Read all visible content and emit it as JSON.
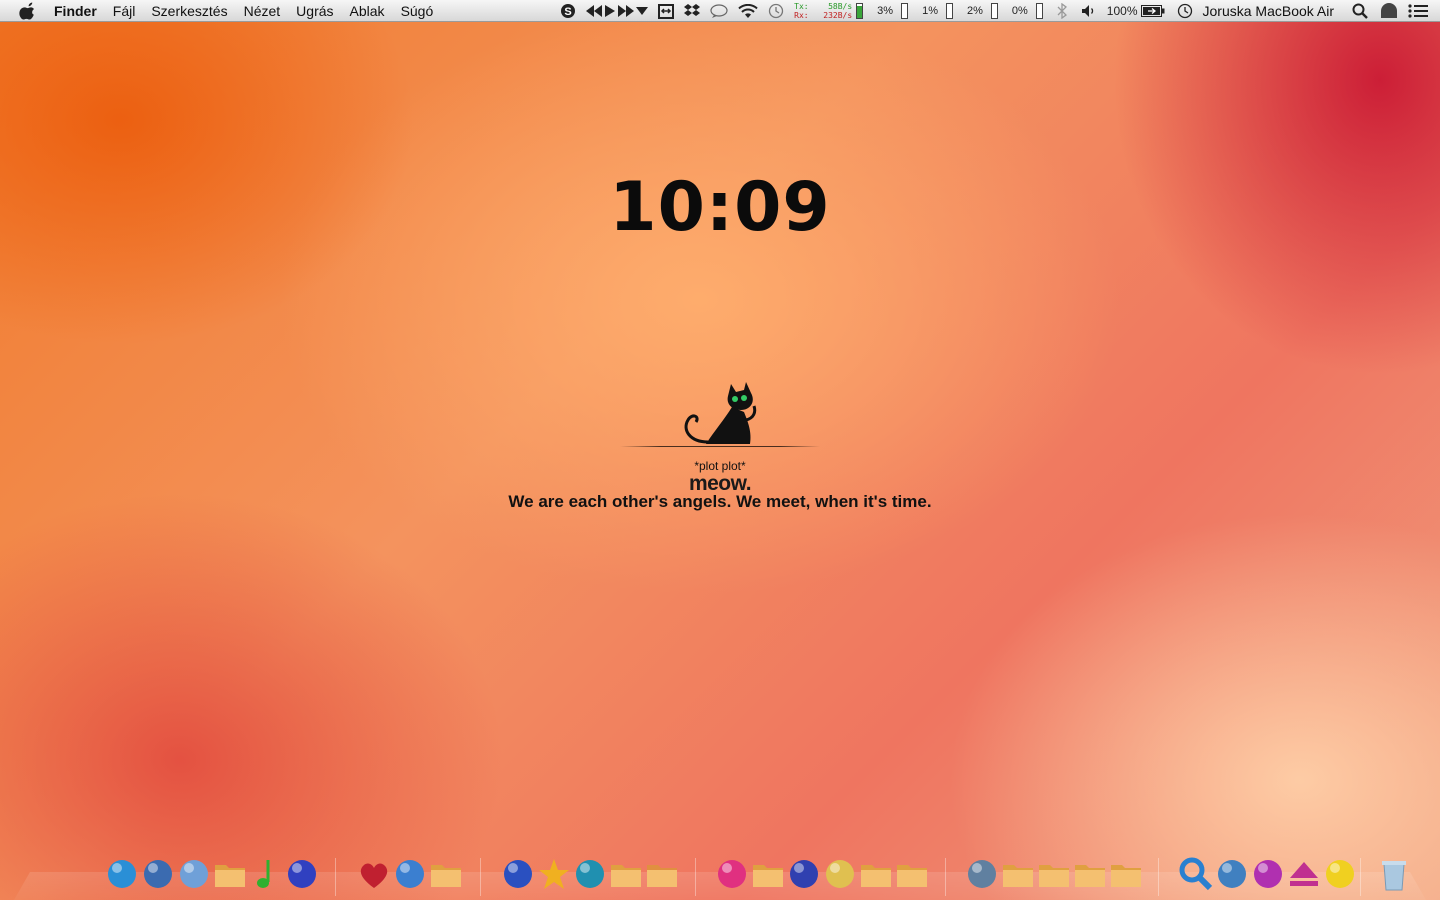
{
  "menubar": {
    "app_name": "Finder",
    "items": [
      "Fájl",
      "Szerkesztés",
      "Nézet",
      "Ugrás",
      "Ablak",
      "Súgó"
    ],
    "network": {
      "tx_label": "Tx:",
      "tx_value": "58B/s",
      "rx_label": "Rx:",
      "rx_value": "232B/s"
    },
    "cpu_percent": "3%",
    "meters": [
      "1%",
      "2%",
      "0%"
    ],
    "battery_percent": "100%",
    "username": "Joruska MacBook Air"
  },
  "desktop": {
    "clock": "10:09",
    "cat_caption_small": "*plot plot*",
    "cat_caption_big": "meow.",
    "quote": "We are each other's angels. We meet, when it's time."
  },
  "dock": {
    "apps": [
      {
        "name": "help-icon",
        "color": "#2a8fd6"
      },
      {
        "name": "globe-icon",
        "color": "#3b6bb0"
      },
      {
        "name": "dvd-icon",
        "color": "#6fa0d8"
      },
      {
        "name": "applications-folder-icon",
        "color": "#e0a040"
      },
      {
        "name": "music-note-icon",
        "color": "#30b030"
      },
      {
        "name": "glove-icon",
        "color": "#3040c0"
      },
      {
        "name": "heart-icon",
        "color": "#c02030"
      },
      {
        "name": "wrench-icon",
        "color": "#3b7fd0"
      },
      {
        "name": "tools-folder-icon",
        "color": "#e0a040"
      },
      {
        "name": "photo-stack-icon",
        "color": "#2a50c0"
      },
      {
        "name": "star-icon",
        "color": "#f0b020"
      },
      {
        "name": "time-machine-icon",
        "color": "#2090b0"
      },
      {
        "name": "red-folder-icon",
        "color": "#e0a040"
      },
      {
        "name": "plus-folder-icon",
        "color": "#e09040"
      },
      {
        "name": "camera-icon",
        "color": "#e03080"
      },
      {
        "name": "pictures-folder-icon",
        "color": "#e0a040"
      },
      {
        "name": "movie-clapper-icon",
        "color": "#3040b0"
      },
      {
        "name": "cd-icon",
        "color": "#e0c050"
      },
      {
        "name": "movies-folder-icon",
        "color": "#e0a040"
      },
      {
        "name": "green-folder-icon",
        "color": "#e0a040"
      },
      {
        "name": "terminal-icon",
        "color": "#6080a0"
      },
      {
        "name": "home-folder-icon",
        "color": "#e0a040"
      },
      {
        "name": "user-folder-icon",
        "color": "#e0a040"
      },
      {
        "name": "video-folder-icon",
        "color": "#e0a040"
      },
      {
        "name": "grid-folder-icon",
        "color": "#e0a040"
      },
      {
        "name": "magnifier-icon",
        "color": "#2a80d0"
      },
      {
        "name": "preview-icon",
        "color": "#4080c0"
      },
      {
        "name": "mail-icon",
        "color": "#b030b0"
      },
      {
        "name": "eject-icon",
        "color": "#c03090"
      },
      {
        "name": "radiation-icon",
        "color": "#f0d020"
      },
      {
        "name": "trash-icon",
        "color": "#aac8e0"
      }
    ]
  }
}
